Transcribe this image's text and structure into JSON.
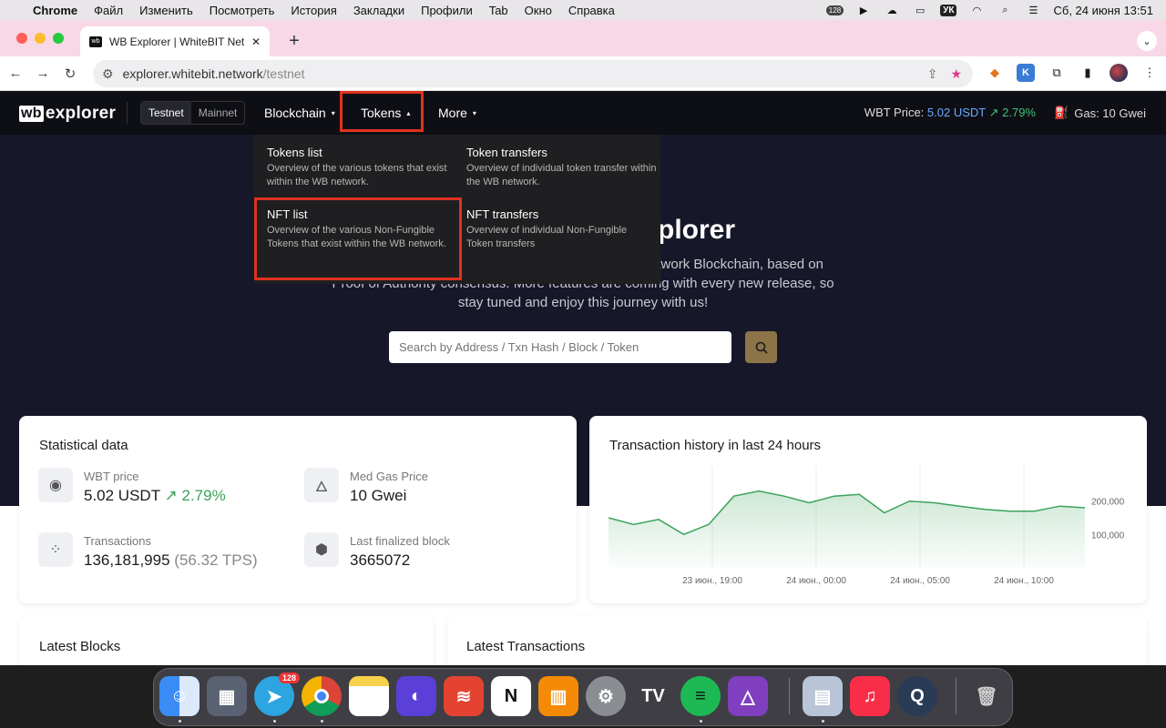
{
  "menubar": {
    "app": "Chrome",
    "items": [
      "Файл",
      "Изменить",
      "Посмотреть",
      "История",
      "Закладки",
      "Профили",
      "Tab",
      "Окно",
      "Справка"
    ],
    "notif_count": "128",
    "keyboard": "УК",
    "datetime": "Сб, 24 июня  13:51"
  },
  "browser": {
    "tab_title": "WB Explorer | WhiteBIT Network",
    "tab_icon": "wb",
    "url_host": "explorer.whitebit.network",
    "url_path": "/testnet"
  },
  "site": {
    "logo_wb": "wb",
    "logo_text": "explorer",
    "network": {
      "testnet": "Testnet",
      "mainnet": "Mainnet"
    },
    "nav": {
      "blockchain": "Blockchain",
      "tokens": "Tokens",
      "more": "More"
    },
    "price_label": "WBT Price:",
    "price_value": "5.02 USDT",
    "price_change": "↗ 2.79%",
    "gas": "Gas: 10 Gwei",
    "highlight_color": "#e0321f"
  },
  "dropdown": {
    "tokens_list": {
      "title": "Tokens list",
      "desc": "Overview of the various tokens that exist within the WB network."
    },
    "token_transfers": {
      "title": "Token transfers",
      "desc": "Overview of individual token transfer within the WB network."
    },
    "nft_list": {
      "title": "NFT list",
      "desc": "Overview of the various Non-Fungible Tokens that exist within the WB network."
    },
    "nft_transfers": {
      "title": "NFT transfers",
      "desc": "Overview of individual Non-Fungible Token transfers"
    }
  },
  "hero": {
    "title_visible": "plorer",
    "subtitle_line1": "twork Blockchain, based on",
    "subtitle_line2": "Proof of Authority consensus. More features are coming with every new release, so",
    "subtitle_line3": "stay tuned and enjoy this journey with us!",
    "search_placeholder": "Search by Address / Txn Hash / Block / Token"
  },
  "stats": {
    "title": "Statistical data",
    "wbt_price_label": "WBT price",
    "wbt_price_value": "5.02 USDT",
    "wbt_price_change": "↗ 2.79%",
    "gas_label": "Med Gas Price",
    "gas_value": "10 Gwei",
    "tx_label": "Transactions",
    "tx_value": "136,181,995",
    "tx_tps": "(56.32 TPS)",
    "block_label": "Last finalized block",
    "block_value": "3665072"
  },
  "chart_data": {
    "type": "area",
    "title": "Transaction history in last 24 hours",
    "x": [
      "23 июн., 19:00",
      "24 июн., 00:00",
      "24 июн., 05:00",
      "24 июн., 10:00"
    ],
    "y_ticks": [
      "200,000",
      "100,000"
    ],
    "values": [
      150000,
      130000,
      145000,
      100000,
      130000,
      215000,
      230000,
      215000,
      195000,
      215000,
      220000,
      165000,
      200000,
      195000,
      185000,
      175000,
      170000,
      170000,
      185000,
      180000
    ]
  },
  "sections": {
    "latest_blocks": "Latest Blocks",
    "latest_transactions": "Latest Transactions"
  },
  "dock": {
    "telegram_badge": "128"
  }
}
